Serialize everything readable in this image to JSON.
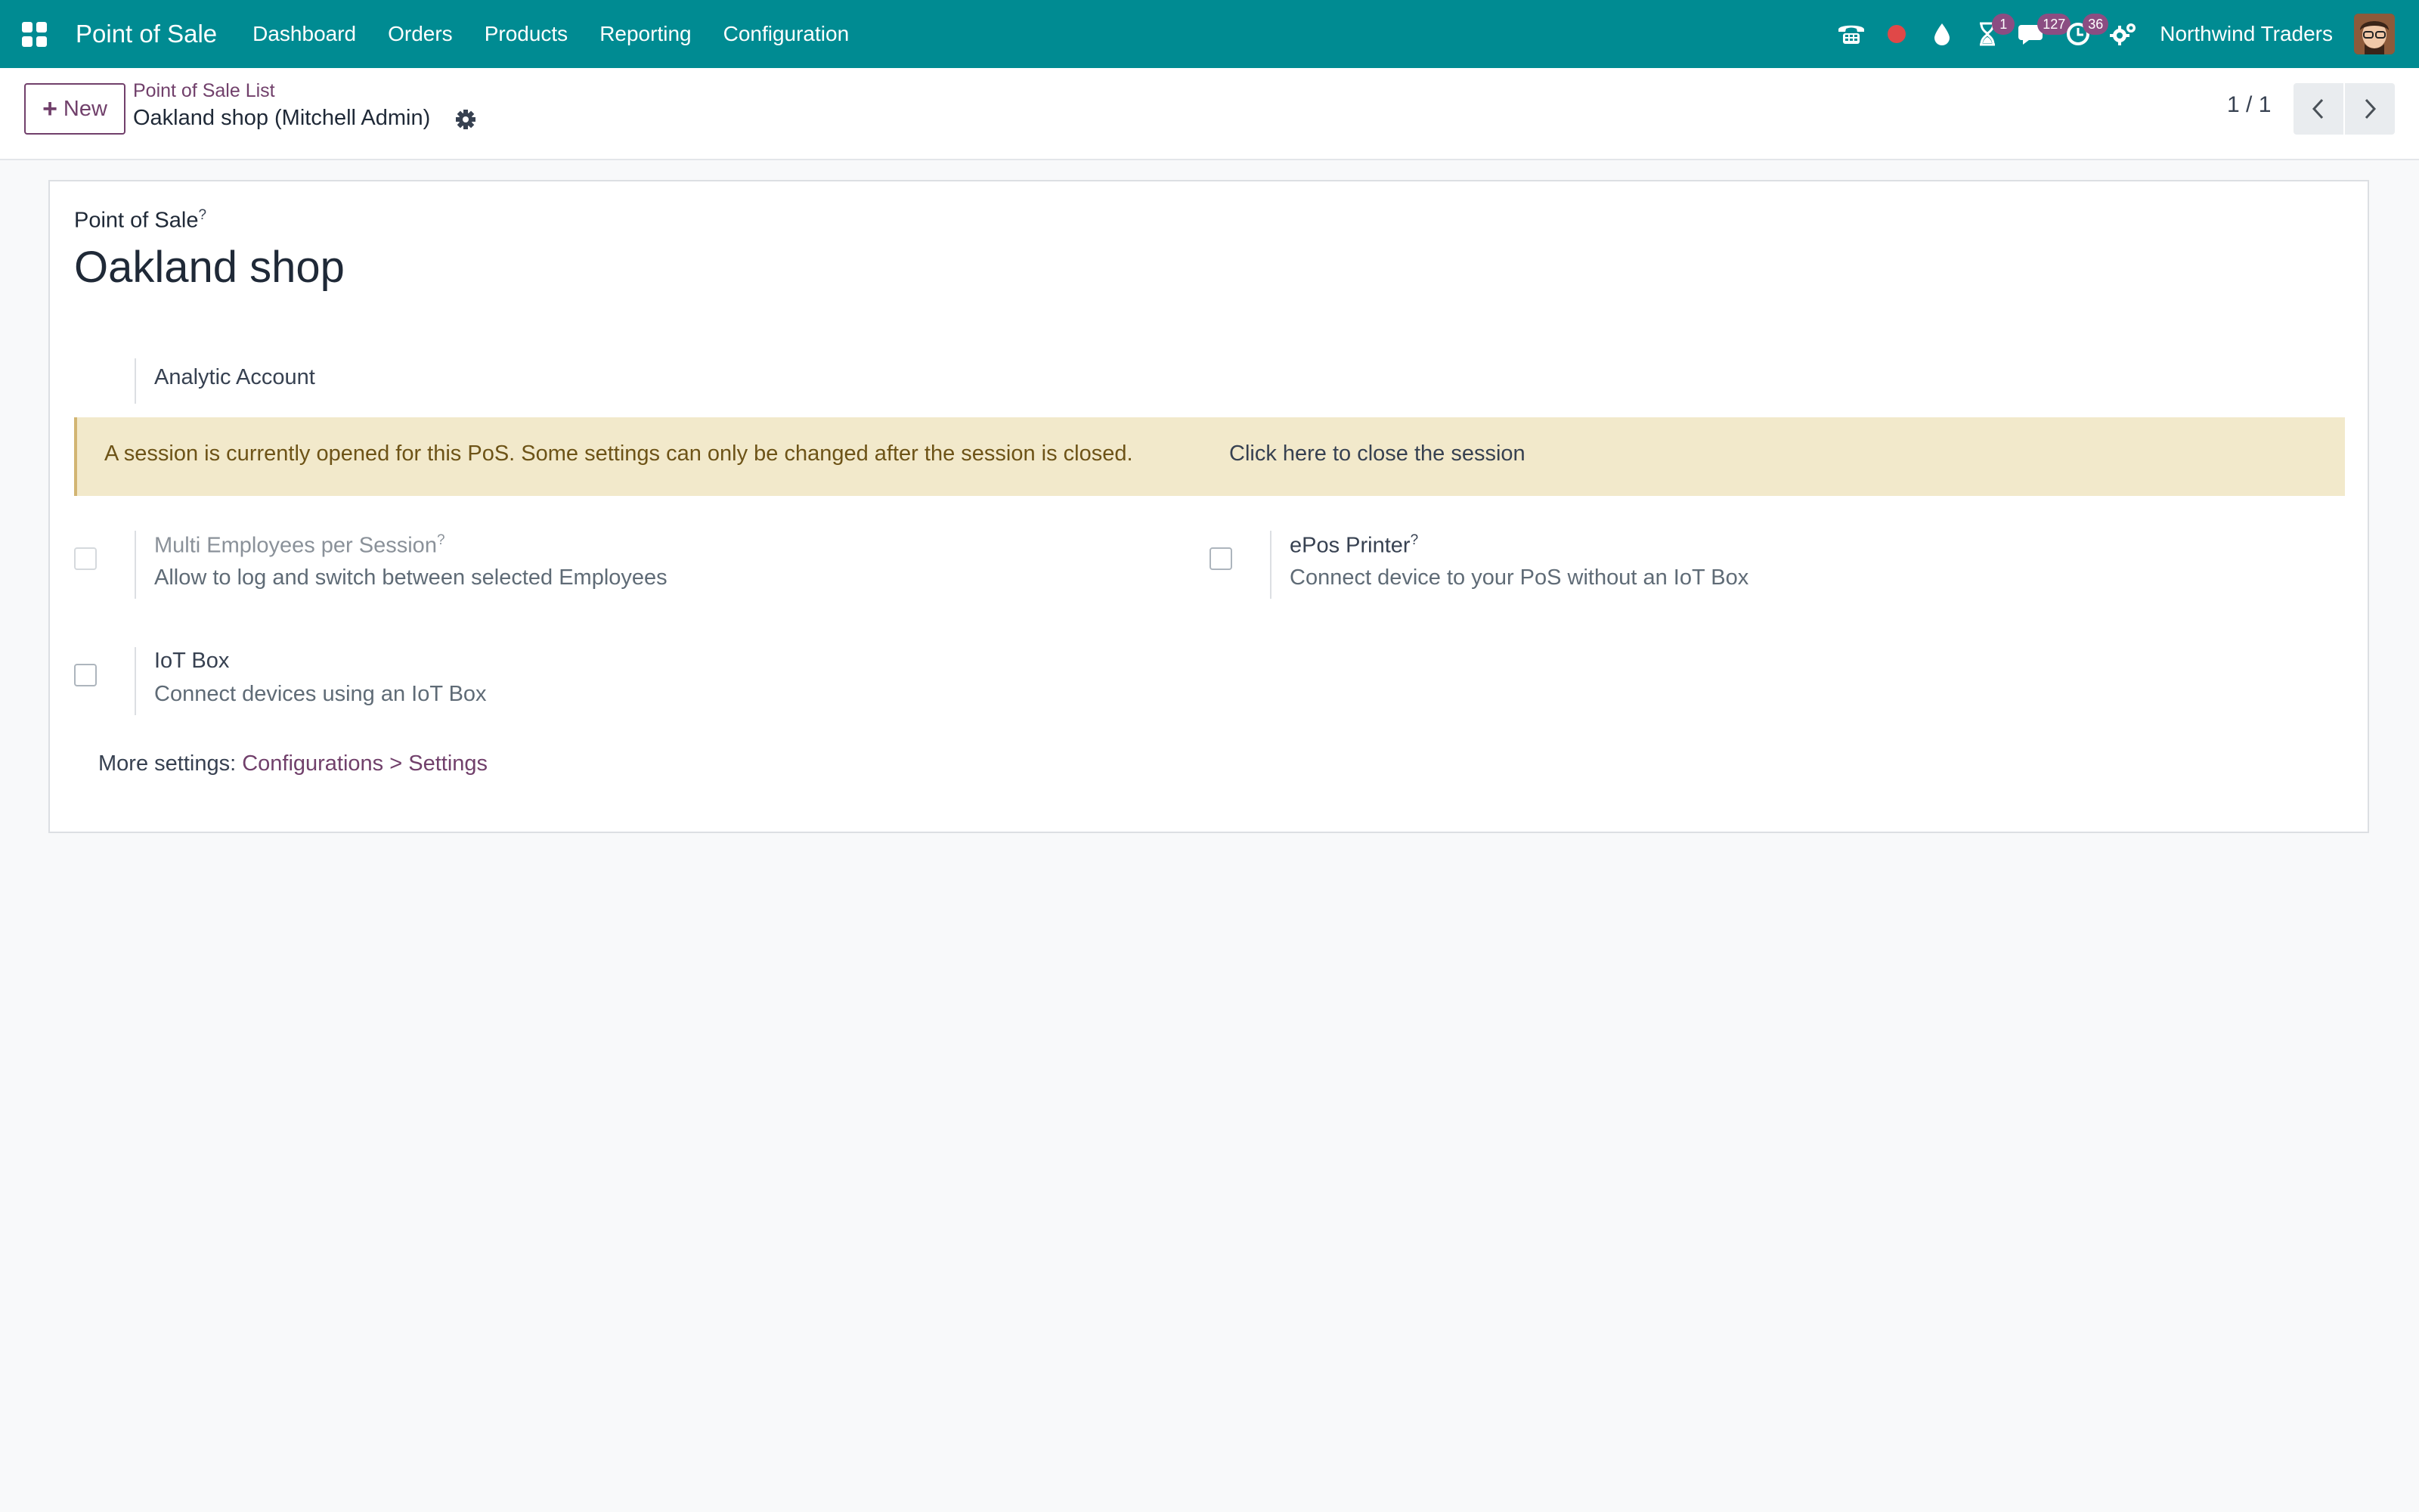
{
  "navbar": {
    "app_title": "Point of Sale",
    "menu": [
      "Dashboard",
      "Orders",
      "Products",
      "Reporting",
      "Configuration"
    ],
    "activity_badge": "1",
    "messages_badge": "127",
    "activities_badge": "36",
    "company": "Northwind Traders"
  },
  "control_panel": {
    "new_label": "New",
    "breadcrumb": "Point of Sale List",
    "record_title": "Oakland shop (Mitchell Admin)",
    "pager": "1 / 1"
  },
  "form": {
    "field_label": "Point of Sale",
    "help_mark": "?",
    "name": "Oakland shop",
    "analytic_label": "Analytic Account",
    "alert_text": "A session is currently opened for this PoS. Some settings can only be changed after the session is closed.",
    "alert_link": "Click here to close the session",
    "settings": {
      "multi_employees": {
        "title": "Multi Employees per Session",
        "desc": "Allow to log and switch between selected Employees",
        "checked": false,
        "disabled": true
      },
      "epos_printer": {
        "title": "ePos Printer",
        "desc": "Connect device to your PoS without an IoT Box",
        "checked": false
      },
      "iot_box": {
        "title": "IoT Box",
        "desc": "Connect devices using an IoT Box",
        "checked": false
      }
    },
    "more_settings_prefix": "More settings: ",
    "more_settings_link": "Configurations > Settings"
  },
  "colors": {
    "navbar": "#008b92",
    "accent": "#71406b",
    "alert_bg": "#f2e9cb",
    "alert_text": "#6d5317",
    "badge": "#8b4d82",
    "recording_dot": "#e04848"
  }
}
